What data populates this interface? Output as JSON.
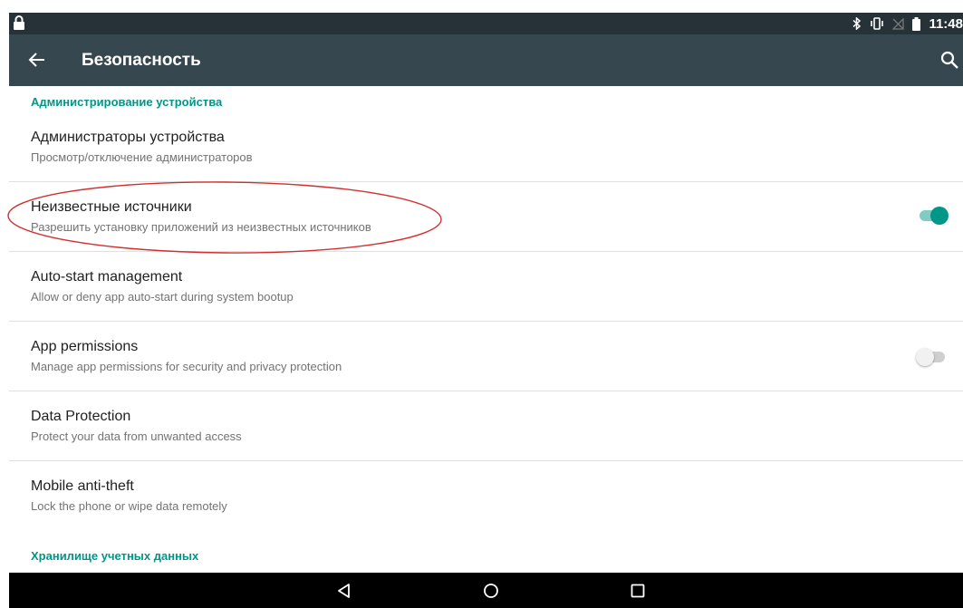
{
  "status_bar": {
    "time": "11:48",
    "icons": [
      "lock-icon",
      "bluetooth-icon",
      "vibrate-icon",
      "no-signal-icon",
      "battery-icon"
    ]
  },
  "app_bar": {
    "title": "Безопасность",
    "back_icon": "back-arrow-icon",
    "search_icon": "search-icon",
    "color": "#37474f"
  },
  "sections": [
    {
      "header": "Администрирование устройства",
      "items": [
        {
          "title": "Администраторы устройства",
          "summary": "Просмотр/отключение администраторов"
        },
        {
          "title": "Неизвестные источники",
          "summary": "Разрешить установку приложений из неизвестных источников",
          "switch": true,
          "highlighted": true
        },
        {
          "title": "Auto-start management",
          "summary": "Allow or deny app auto-start during system bootup"
        },
        {
          "title": "App permissions",
          "summary": "Manage app permissions for security and privacy protection",
          "switch": false
        },
        {
          "title": "Data Protection",
          "summary": "Protect your data from unwanted access"
        },
        {
          "title": "Mobile anti-theft",
          "summary": "Lock the phone or wipe data remotely"
        }
      ]
    },
    {
      "header": "Хранилище учетных данных",
      "items": []
    }
  ],
  "nav_bar": [
    "back-triangle-icon",
    "home-circle-icon",
    "recents-square-icon"
  ],
  "colors": {
    "accent": "#009688",
    "highlight_ring": "#d32f2f"
  }
}
